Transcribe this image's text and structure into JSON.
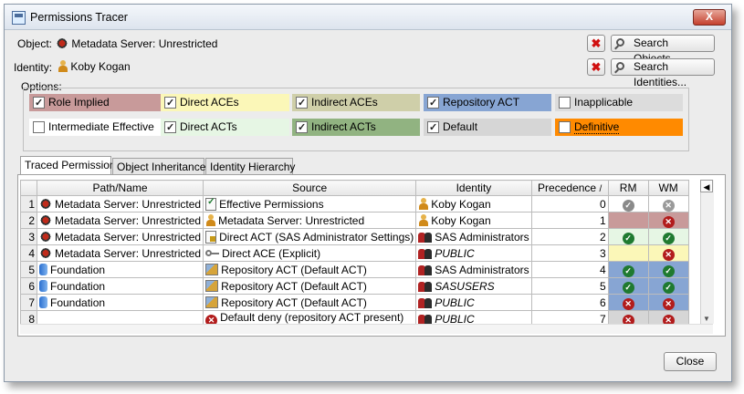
{
  "window": {
    "title": "Permissions Tracer",
    "close_glyph": "X"
  },
  "object": {
    "label": "Object:",
    "value": "Metadata Server: Unrestricted",
    "icon": "metadata-server-icon"
  },
  "identity": {
    "label": "Identity:",
    "value": "Koby Kogan",
    "icon": "user-icon"
  },
  "buttons": {
    "clear_glyph": "✖",
    "search_objects": "Search Objects...",
    "search_identities": "Search Identities...",
    "close": "Close"
  },
  "options": {
    "label": "Options:",
    "items": [
      {
        "label": "Role Implied",
        "checked": true,
        "color": "#c89a9a"
      },
      {
        "label": "Direct ACEs",
        "checked": true,
        "color": "#fbf7b8"
      },
      {
        "label": "Indirect ACEs",
        "checked": true,
        "color": "#cfcfa9"
      },
      {
        "label": "Repository ACT",
        "checked": true,
        "color": "#87a5d3"
      },
      {
        "label": "Inapplicable",
        "checked": false,
        "color": "#dcdcdc"
      },
      {
        "label": "Intermediate Effective",
        "checked": false,
        "color": "#ffffff"
      },
      {
        "label": "Direct ACTs",
        "checked": true,
        "color": "#e6f6e4"
      },
      {
        "label": "Indirect ACTs",
        "checked": true,
        "color": "#91b381"
      },
      {
        "label": "Default",
        "checked": true,
        "color": "#d6d6d6"
      },
      {
        "label": "Definitive",
        "checked": false,
        "color": "#ff8a00"
      }
    ]
  },
  "tabs": [
    "Traced Permissions",
    "Object Inheritance",
    "Identity Hierarchy"
  ],
  "table": {
    "columns": [
      "Path/Name",
      "Source",
      "Identity",
      "Precedence",
      "RM",
      "WM"
    ],
    "sort_indicator": "/",
    "rows": [
      {
        "n": "1",
        "path": "Metadata Server: Unrestricted",
        "path_icon": "metadata-server-icon",
        "source": "Effective Permissions",
        "source_icon": "effective-permissions-icon",
        "identity": "Koby Kogan",
        "identity_icon": "user-icon",
        "identity_italic": false,
        "prec": "0",
        "rm": "grant-gray",
        "wm": "deny-gray",
        "rm_bg": "#ffffff",
        "wm_bg": "#ffffff"
      },
      {
        "n": "2",
        "path": "Metadata Server: Unrestricted",
        "path_icon": "metadata-server-icon",
        "source": "Metadata Server: Unrestricted",
        "source_icon": "role-icon",
        "identity": "Koby Kogan",
        "identity_icon": "user-icon",
        "identity_italic": false,
        "prec": "1",
        "rm": "",
        "wm": "deny",
        "rm_bg": "#c89a9a",
        "wm_bg": "#c89a9a"
      },
      {
        "n": "3",
        "path": "Metadata Server: Unrestricted",
        "path_icon": "metadata-server-icon",
        "source": "Direct ACT (SAS Administrator Settings)",
        "source_icon": "acl-template-icon",
        "identity": "SAS Administrators",
        "identity_icon": "group-icon",
        "identity_italic": false,
        "prec": "2",
        "rm": "grant",
        "wm": "grant",
        "rm_bg": "#e6f6e4",
        "wm_bg": "#e6f6e4"
      },
      {
        "n": "4",
        "path": "Metadata Server: Unrestricted",
        "path_icon": "metadata-server-icon",
        "source": "Direct ACE (Explicit)",
        "source_icon": "key-icon",
        "identity": "PUBLIC",
        "identity_icon": "group-icon",
        "identity_italic": true,
        "prec": "3",
        "rm": "",
        "wm": "deny",
        "rm_bg": "#fbf7b8",
        "wm_bg": "#fbf7b8"
      },
      {
        "n": "5",
        "path": "Foundation",
        "path_icon": "repository-icon",
        "source": "Repository ACT (Default ACT)",
        "source_icon": "repository-act-icon",
        "identity": "SAS Administrators",
        "identity_icon": "group-icon",
        "identity_italic": false,
        "prec": "4",
        "rm": "grant",
        "wm": "grant",
        "rm_bg": "#87a5d3",
        "wm_bg": "#87a5d3"
      },
      {
        "n": "6",
        "path": "Foundation",
        "path_icon": "repository-icon",
        "source": "Repository ACT (Default ACT)",
        "source_icon": "repository-act-icon",
        "identity": "SASUSERS",
        "identity_icon": "group-icon",
        "identity_italic": true,
        "prec": "5",
        "rm": "grant",
        "wm": "grant",
        "rm_bg": "#87a5d3",
        "wm_bg": "#87a5d3"
      },
      {
        "n": "7",
        "path": "Foundation",
        "path_icon": "repository-icon",
        "source": "Repository ACT (Default ACT)",
        "source_icon": "repository-act-icon",
        "identity": "PUBLIC",
        "identity_icon": "group-icon",
        "identity_italic": true,
        "prec": "6",
        "rm": "deny",
        "wm": "deny",
        "rm_bg": "#87a5d3",
        "wm_bg": "#87a5d3"
      },
      {
        "n": "8",
        "path": "",
        "path_icon": "",
        "source": "Default deny (repository ACT present)",
        "source_icon": "deny-icon",
        "identity": "PUBLIC",
        "identity_icon": "group-icon",
        "identity_italic": true,
        "prec": "7",
        "rm": "deny",
        "wm": "deny",
        "rm_bg": "#d6d6d6",
        "wm_bg": "#d6d6d6"
      }
    ]
  }
}
